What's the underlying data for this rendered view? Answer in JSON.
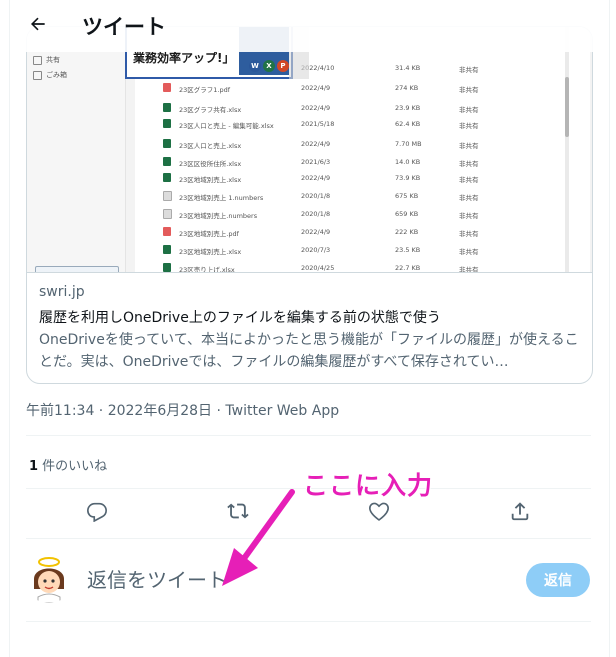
{
  "header": {
    "back_icon": "arrow-left-icon",
    "title": "ツイート"
  },
  "card": {
    "media": {
      "sidebar_items": [
        "共有",
        "ごみ箱"
      ],
      "banner_text": "業務効率アップ!」",
      "banner_badges": [
        {
          "letter": "W",
          "color": "#2b579a"
        },
        {
          "letter": "X",
          "color": "#217346"
        },
        {
          "letter": "P",
          "color": "#d24726"
        }
      ],
      "files": [
        {
          "type": "pdf",
          "name": "",
          "date": "2022/4/10",
          "size": "31.4 KB",
          "share": "非共有"
        },
        {
          "type": "pdf",
          "name": "23区グラフ1.pdf",
          "date": "2022/4/9",
          "size": "274 KB",
          "share": "非共有"
        },
        {
          "type": "xl",
          "name": "23区グラフ共有.xlsx",
          "date": "2022/4/9",
          "size": "23.9 KB",
          "share": "非共有"
        },
        {
          "type": "xl",
          "name": "23区人口と売上 - 編集可能.xlsx",
          "date": "2021/5/18",
          "size": "62.4 KB",
          "share": "非共有"
        },
        {
          "type": "xl",
          "name": "23区人口と売上.xlsx",
          "date": "2022/4/9",
          "size": "7.70 MB",
          "share": "非共有"
        },
        {
          "type": "xl",
          "name": "23区区役所住所.xlsx",
          "date": "2021/6/3",
          "size": "14.0 KB",
          "share": "非共有"
        },
        {
          "type": "xl",
          "name": "23区地域別売上.xlsx",
          "date": "2022/4/9",
          "size": "73.9 KB",
          "share": "非共有"
        },
        {
          "type": "num",
          "name": "23区地域別売上 1.numbers",
          "date": "2020/1/8",
          "size": "675 KB",
          "share": "非共有"
        },
        {
          "type": "num",
          "name": "23区地域別売上.numbers",
          "date": "2020/1/8",
          "size": "659 KB",
          "share": "非共有"
        },
        {
          "type": "pdf",
          "name": "23区地域別売上.pdf",
          "date": "2022/4/9",
          "size": "222 KB",
          "share": "非共有"
        },
        {
          "type": "xl",
          "name": "23区地域別売上.xlsx",
          "date": "2020/7/3",
          "size": "23.5 KB",
          "share": "非共有"
        },
        {
          "type": "xl",
          "name": "23区売り上げ.xlsx",
          "date": "2020/4/25",
          "size": "22.7 KB",
          "share": "非共有"
        }
      ]
    },
    "domain": "swri.jp",
    "title": "履歴を利用しOneDrive上のファイルを編集する前の状態で使う",
    "description": "OneDriveを使っていて、本当によかったと思う機能が「ファイルの履歴」が使えることだ。実は、OneDriveでは、ファイルの編集履歴がすべて保存されてい…"
  },
  "meta": {
    "timestamp": "午前11:34 · 2022年6月28日 · Twitter Web App"
  },
  "likes": {
    "count": "1",
    "label": " 件のいいね"
  },
  "actions": {
    "reply_icon": "reply-icon",
    "retweet_icon": "retweet-icon",
    "like_icon": "heart-icon",
    "share_icon": "share-icon"
  },
  "annotation": {
    "text": "ここに入力"
  },
  "reply": {
    "placeholder": "返信をツイート",
    "button_label": "返信"
  },
  "colors": {
    "accent": "#1d9bf0",
    "reply_button_disabled": "#8ecdf7",
    "annotation": "#e61fb7",
    "secondary_text": "#536471"
  }
}
